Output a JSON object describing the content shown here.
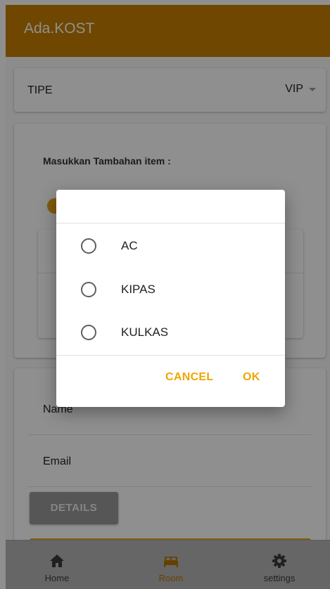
{
  "app": {
    "title": "Ada.KOST"
  },
  "tipe": {
    "label": "TIPE",
    "value": "VIP"
  },
  "items_section": {
    "label": "Masukkan Tambahan item :"
  },
  "form": {
    "name_label": "Name",
    "email_label": "Email",
    "details_label": "DETAILS"
  },
  "dialog": {
    "options": [
      "AC",
      "KIPAS",
      "KULKAS"
    ],
    "cancel_label": "CANCEL",
    "ok_label": "OK"
  },
  "tabs": [
    {
      "label": "Home",
      "icon": "home-icon"
    },
    {
      "label": "Room",
      "icon": "bed-icon",
      "active": true
    },
    {
      "label": "settings",
      "icon": "gear-icon"
    }
  ],
  "colors": {
    "accent": "#c77f00",
    "button_accent": "#e7a21c",
    "dialog_button": "#f0a500",
    "tab_active": "#b57400"
  }
}
